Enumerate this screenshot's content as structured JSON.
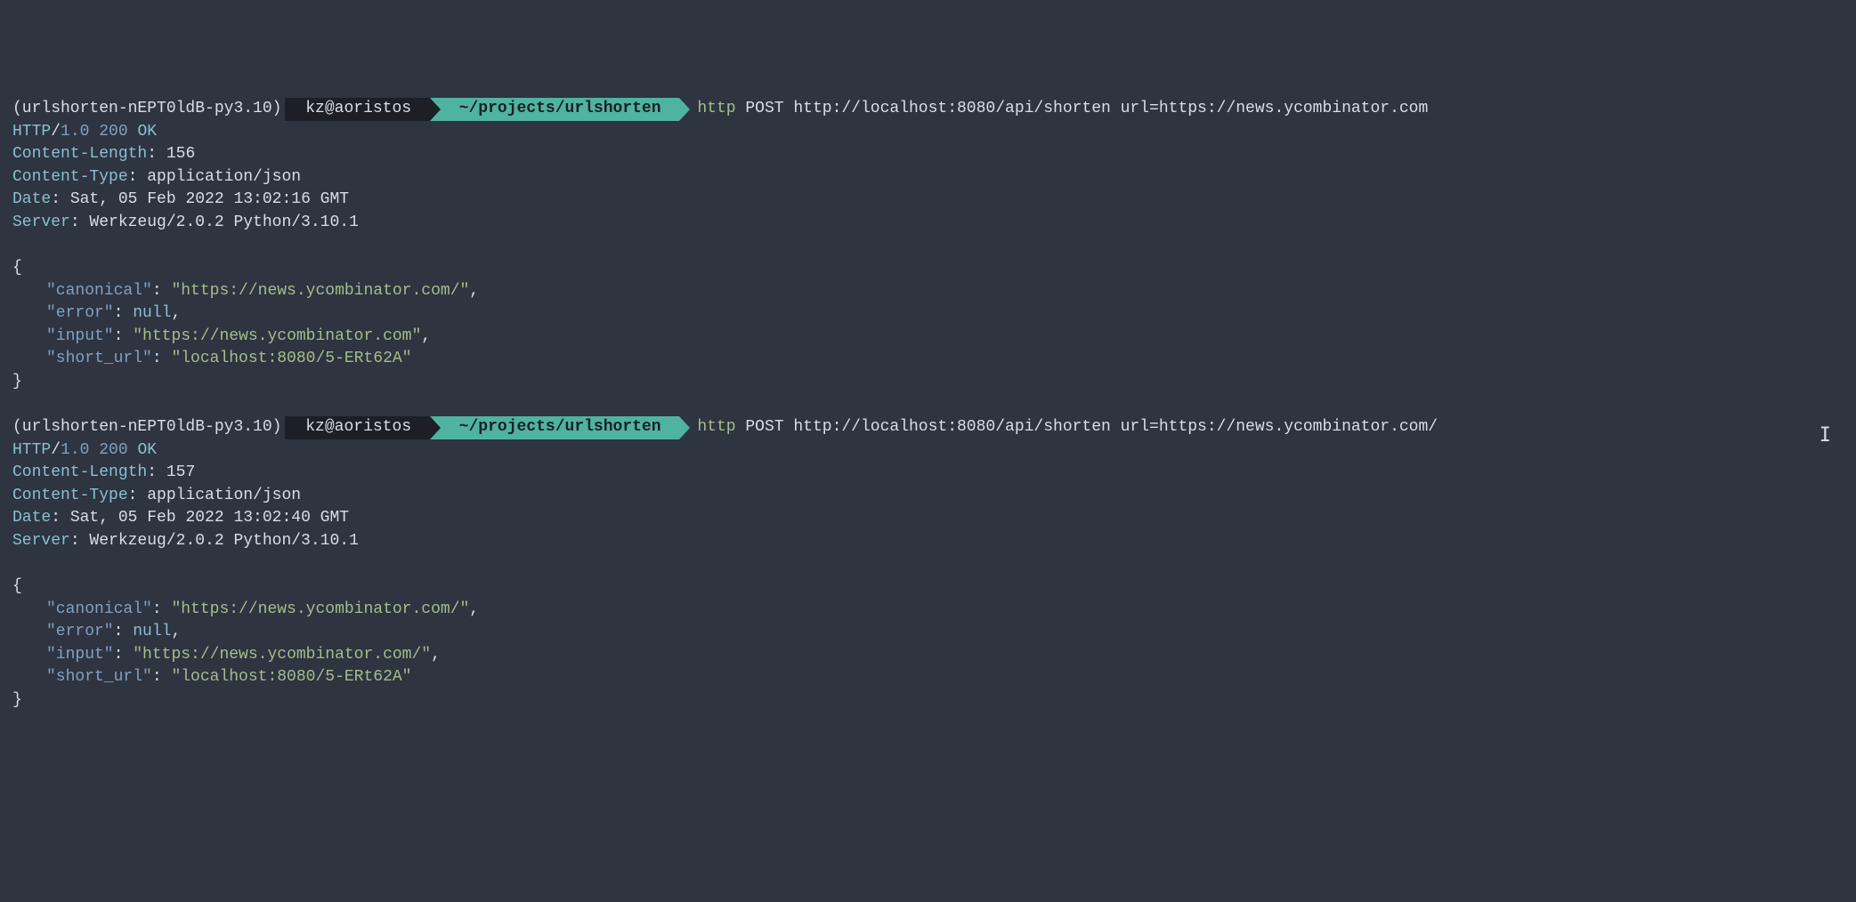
{
  "requests": [
    {
      "prompt": {
        "venv": "(urlshorten-nEPT0ldB-py3.10)",
        "user_host": "kz@aoristos",
        "path": "~/projects/urlshorten",
        "cmd_verb": "http",
        "cmd_rest": " POST http://localhost:8080/api/shorten url=https://news.ycombinator.com"
      },
      "status": {
        "proto": "HTTP",
        "slash": "/",
        "version": "1.0",
        "code": "200",
        "reason": "OK"
      },
      "headers": [
        {
          "name": "Content-Length",
          "value": "156"
        },
        {
          "name": "Content-Type",
          "value": "application/json"
        },
        {
          "name": "Date",
          "value": "Sat, 05 Feb 2022 13:02:16 GMT"
        },
        {
          "name": "Server",
          "value": "Werkzeug/2.0.2 Python/3.10.1"
        }
      ],
      "json": {
        "open": "{",
        "close": "}",
        "rows": [
          {
            "key": "\"canonical\"",
            "sep": ": ",
            "val": "\"https://news.ycombinator.com/\"",
            "type": "string",
            "trail": ","
          },
          {
            "key": "\"error\"",
            "sep": ": ",
            "val": "null",
            "type": "null",
            "trail": ","
          },
          {
            "key": "\"input\"",
            "sep": ": ",
            "val": "\"https://news.ycombinator.com\"",
            "type": "string",
            "trail": ","
          },
          {
            "key": "\"short_url\"",
            "sep": ": ",
            "val": "\"localhost:8080/5-ERt62A\"",
            "type": "string",
            "trail": ""
          }
        ]
      }
    },
    {
      "prompt": {
        "venv": "(urlshorten-nEPT0ldB-py3.10)",
        "user_host": "kz@aoristos",
        "path": "~/projects/urlshorten",
        "cmd_verb": "http",
        "cmd_rest": " POST http://localhost:8080/api/shorten url=https://news.ycombinator.com/"
      },
      "status": {
        "proto": "HTTP",
        "slash": "/",
        "version": "1.0",
        "code": "200",
        "reason": "OK"
      },
      "headers": [
        {
          "name": "Content-Length",
          "value": "157"
        },
        {
          "name": "Content-Type",
          "value": "application/json"
        },
        {
          "name": "Date",
          "value": "Sat, 05 Feb 2022 13:02:40 GMT"
        },
        {
          "name": "Server",
          "value": "Werkzeug/2.0.2 Python/3.10.1"
        }
      ],
      "json": {
        "open": "{",
        "close": "}",
        "rows": [
          {
            "key": "\"canonical\"",
            "sep": ": ",
            "val": "\"https://news.ycombinator.com/\"",
            "type": "string",
            "trail": ","
          },
          {
            "key": "\"error\"",
            "sep": ": ",
            "val": "null",
            "type": "null",
            "trail": ","
          },
          {
            "key": "\"input\"",
            "sep": ": ",
            "val": "\"https://news.ycombinator.com/\"",
            "type": "string",
            "trail": ","
          },
          {
            "key": "\"short_url\"",
            "sep": ": ",
            "val": "\"localhost:8080/5-ERt62A\"",
            "type": "string",
            "trail": ""
          }
        ]
      }
    }
  ],
  "cursor_glyph": "𝙸"
}
